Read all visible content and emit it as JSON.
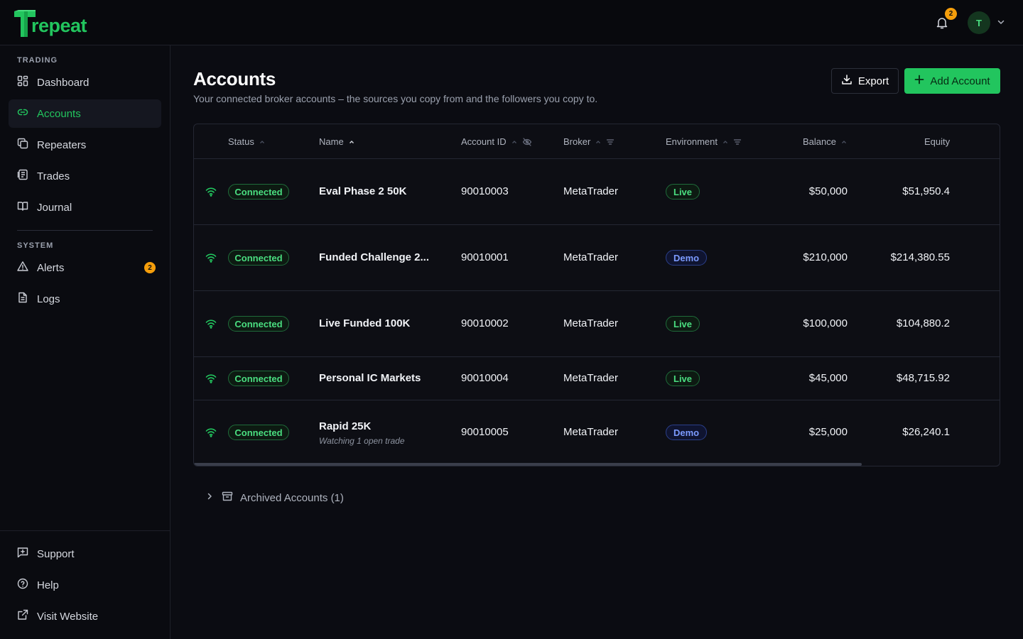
{
  "brand": {
    "name": "repeat",
    "color": "#22c55e"
  },
  "header": {
    "notifications_count": "2",
    "avatar_initial": "T"
  },
  "sidebar": {
    "trading_label": "TRADING",
    "system_label": "SYSTEM",
    "items": [
      {
        "label": "Dashboard",
        "icon": "dashboard-icon"
      },
      {
        "label": "Accounts",
        "icon": "link-icon",
        "active": true
      },
      {
        "label": "Repeaters",
        "icon": "copy-icon"
      },
      {
        "label": "Trades",
        "icon": "list-icon"
      },
      {
        "label": "Journal",
        "icon": "book-icon"
      }
    ],
    "system_items": [
      {
        "label": "Alerts",
        "icon": "alert-triangle-icon",
        "badge": "2"
      },
      {
        "label": "Logs",
        "icon": "file-icon"
      }
    ],
    "footer_items": [
      {
        "label": "Support",
        "icon": "message-icon"
      },
      {
        "label": "Help",
        "icon": "help-circle-icon"
      },
      {
        "label": "Visit Website",
        "icon": "external-link-icon"
      }
    ]
  },
  "page": {
    "title": "Accounts",
    "subtitle": "Your connected broker accounts – the sources you copy from and the followers you copy to.",
    "export_label": "Export",
    "add_label": "Add Account"
  },
  "table": {
    "columns": [
      "Status",
      "Name",
      "Account ID",
      "Broker",
      "Environment",
      "Balance",
      "Equity"
    ],
    "rows": [
      {
        "status": "Connected",
        "name": "Eval Phase 2 50K",
        "account_id": "90010003",
        "broker": "MetaTrader",
        "environment": "Live",
        "balance": "$50,000",
        "equity": "$51,950.4"
      },
      {
        "status": "Connected",
        "name": "Funded Challenge 2...",
        "account_id": "90010001",
        "broker": "MetaTrader",
        "environment": "Demo",
        "balance": "$210,000",
        "equity": "$214,380.55"
      },
      {
        "status": "Connected",
        "name": "Live Funded 100K",
        "account_id": "90010002",
        "broker": "MetaTrader",
        "environment": "Live",
        "balance": "$100,000",
        "equity": "$104,880.2"
      },
      {
        "status": "Connected",
        "name": "Personal IC Markets",
        "account_id": "90010004",
        "broker": "MetaTrader",
        "environment": "Live",
        "balance": "$45,000",
        "equity": "$48,715.92"
      },
      {
        "status": "Connected",
        "name": "Rapid 25K",
        "note": "Watching 1 open trade",
        "account_id": "90010005",
        "broker": "MetaTrader",
        "environment": "Demo",
        "balance": "$25,000",
        "equity": "$26,240.1"
      }
    ]
  },
  "archived": {
    "label": "Archived Accounts (1)"
  }
}
